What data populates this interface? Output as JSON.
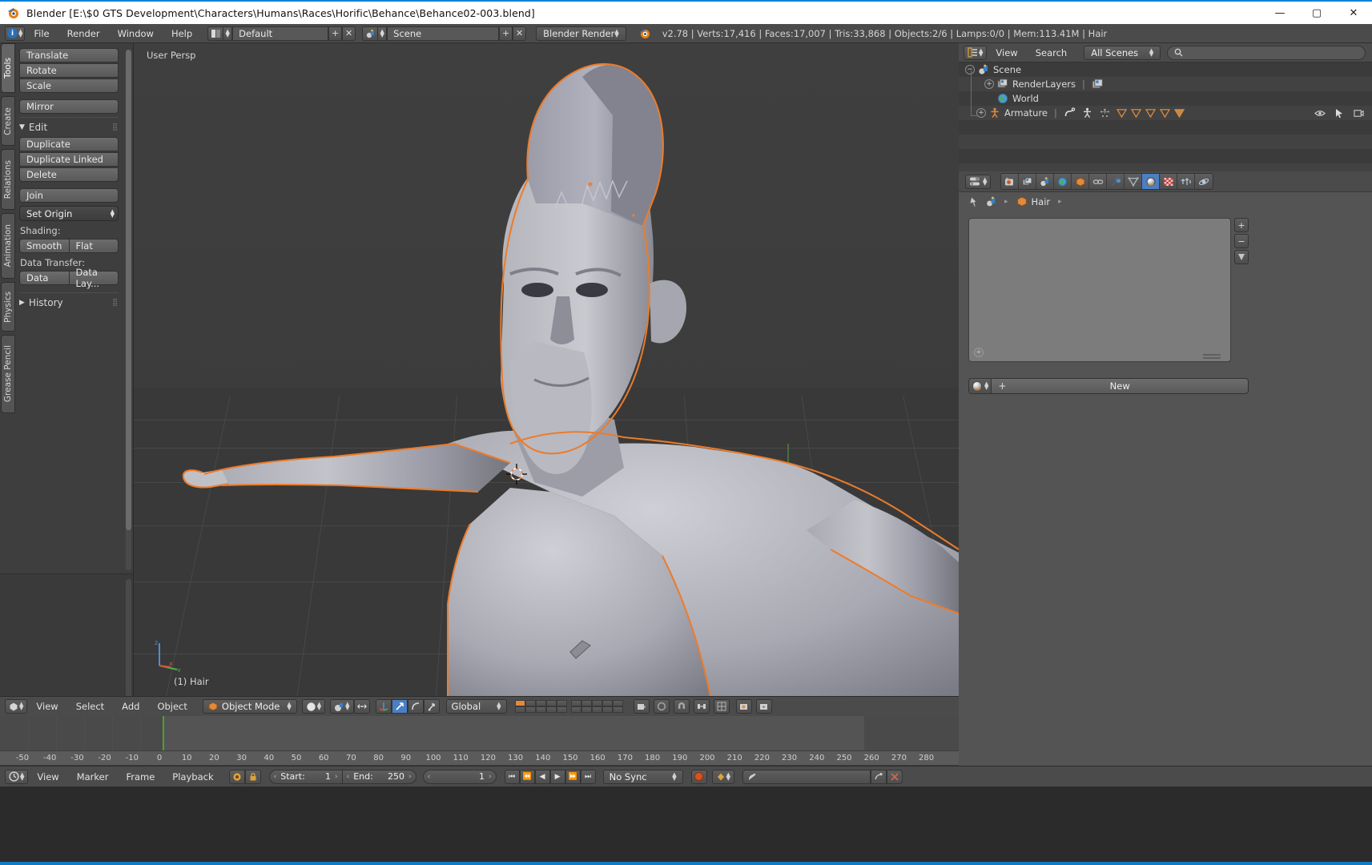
{
  "window": {
    "title": "Blender [E:\\$0 GTS Development\\Characters\\Humans\\Races\\Horific\\Behance\\Behance02-003.blend]",
    "minimize": "—",
    "maximize": "▢",
    "close": "✕"
  },
  "topbar": {
    "menus": [
      "File",
      "Render",
      "Window",
      "Help"
    ],
    "screen_layout": "Default",
    "scene_name": "Scene",
    "render_engine": "Blender Render",
    "status": "v2.78 | Verts:17,416 | Faces:17,007 | Tris:33,868 | Objects:2/6 | Lamps:0/0 | Mem:113.41M | Hair",
    "add_label": "+",
    "remove_label": "✕"
  },
  "toolshelf": {
    "tabs": [
      "Tools",
      "Create",
      "Relations",
      "Animation",
      "Physics",
      "Grease Pencil"
    ],
    "active_tab": "Tools",
    "transform_buttons": [
      "Translate",
      "Rotate",
      "Scale"
    ],
    "mirror_button": "Mirror",
    "edit_section": {
      "title": "Edit",
      "expanded": true,
      "buttons": [
        "Duplicate",
        "Duplicate Linked",
        "Delete"
      ],
      "join": "Join",
      "set_origin": "Set Origin",
      "shading_label": "Shading:",
      "shading_options": [
        "Smooth",
        "Flat"
      ],
      "data_transfer_label": "Data Transfer:",
      "data_transfer_options": [
        "Data",
        "Data Lay..."
      ]
    },
    "history_section": {
      "title": "History",
      "expanded": false
    }
  },
  "viewport": {
    "view_label": "User Persp",
    "object_label": "(1) Hair"
  },
  "viewport_header": {
    "menus": [
      "View",
      "Select",
      "Add",
      "Object"
    ],
    "mode": "Object Mode",
    "transform_orientation": "Global"
  },
  "timeline_ruler": {
    "ticks": [
      -50,
      -40,
      -30,
      -20,
      -10,
      0,
      10,
      20,
      30,
      40,
      50,
      60,
      70,
      80,
      90,
      100,
      110,
      120,
      130,
      140,
      150,
      160,
      170,
      180,
      190,
      200,
      210,
      220,
      230,
      240,
      250,
      260,
      270,
      280
    ],
    "current_frame_marker": 0
  },
  "timeline_header": {
    "menus": [
      "View",
      "Marker",
      "Frame",
      "Playback"
    ],
    "start_label": "Start:",
    "start_value": "1",
    "end_label": "End:",
    "end_value": "250",
    "current_frame": "1",
    "sync_mode": "No Sync",
    "prev_arrow": "‹",
    "next_arrow": "›"
  },
  "outliner": {
    "menus": [
      "View",
      "Search"
    ],
    "display_mode": "All Scenes",
    "search_placeholder": "",
    "rows": [
      {
        "label": "Scene",
        "indent": 0,
        "icon": "scene-icon",
        "expander": "−"
      },
      {
        "label": "RenderLayers",
        "indent": 1,
        "icon": "renderlayers-icon",
        "expander": "+"
      },
      {
        "label": "World",
        "indent": 1,
        "icon": "world-icon",
        "expander": ""
      },
      {
        "label": "Armature",
        "indent": 1,
        "icon": "armature-icon",
        "expander": "+"
      }
    ]
  },
  "properties": {
    "tabs": [
      "render-icon",
      "renderlayers-icon",
      "scene-icon",
      "world-icon",
      "object-icon",
      "constraints-icon",
      "modifiers-icon",
      "data-icon",
      "material-icon",
      "texture-icon",
      "particles-icon",
      "physics-icon"
    ],
    "active_tab": "material-icon",
    "breadcrumb": [
      "Hair"
    ],
    "new_material_label": "New",
    "add_icon": "+"
  },
  "colors": {
    "accent_blue": "#4b7fc4",
    "selection_orange": "#ed7b29",
    "header_gray": "#4b4b4b",
    "panel_gray": "#545454",
    "viewport_gray": "#3d3d3d",
    "playhead_green": "#4ea12c",
    "titlebar_blue": "#0a84d8"
  }
}
